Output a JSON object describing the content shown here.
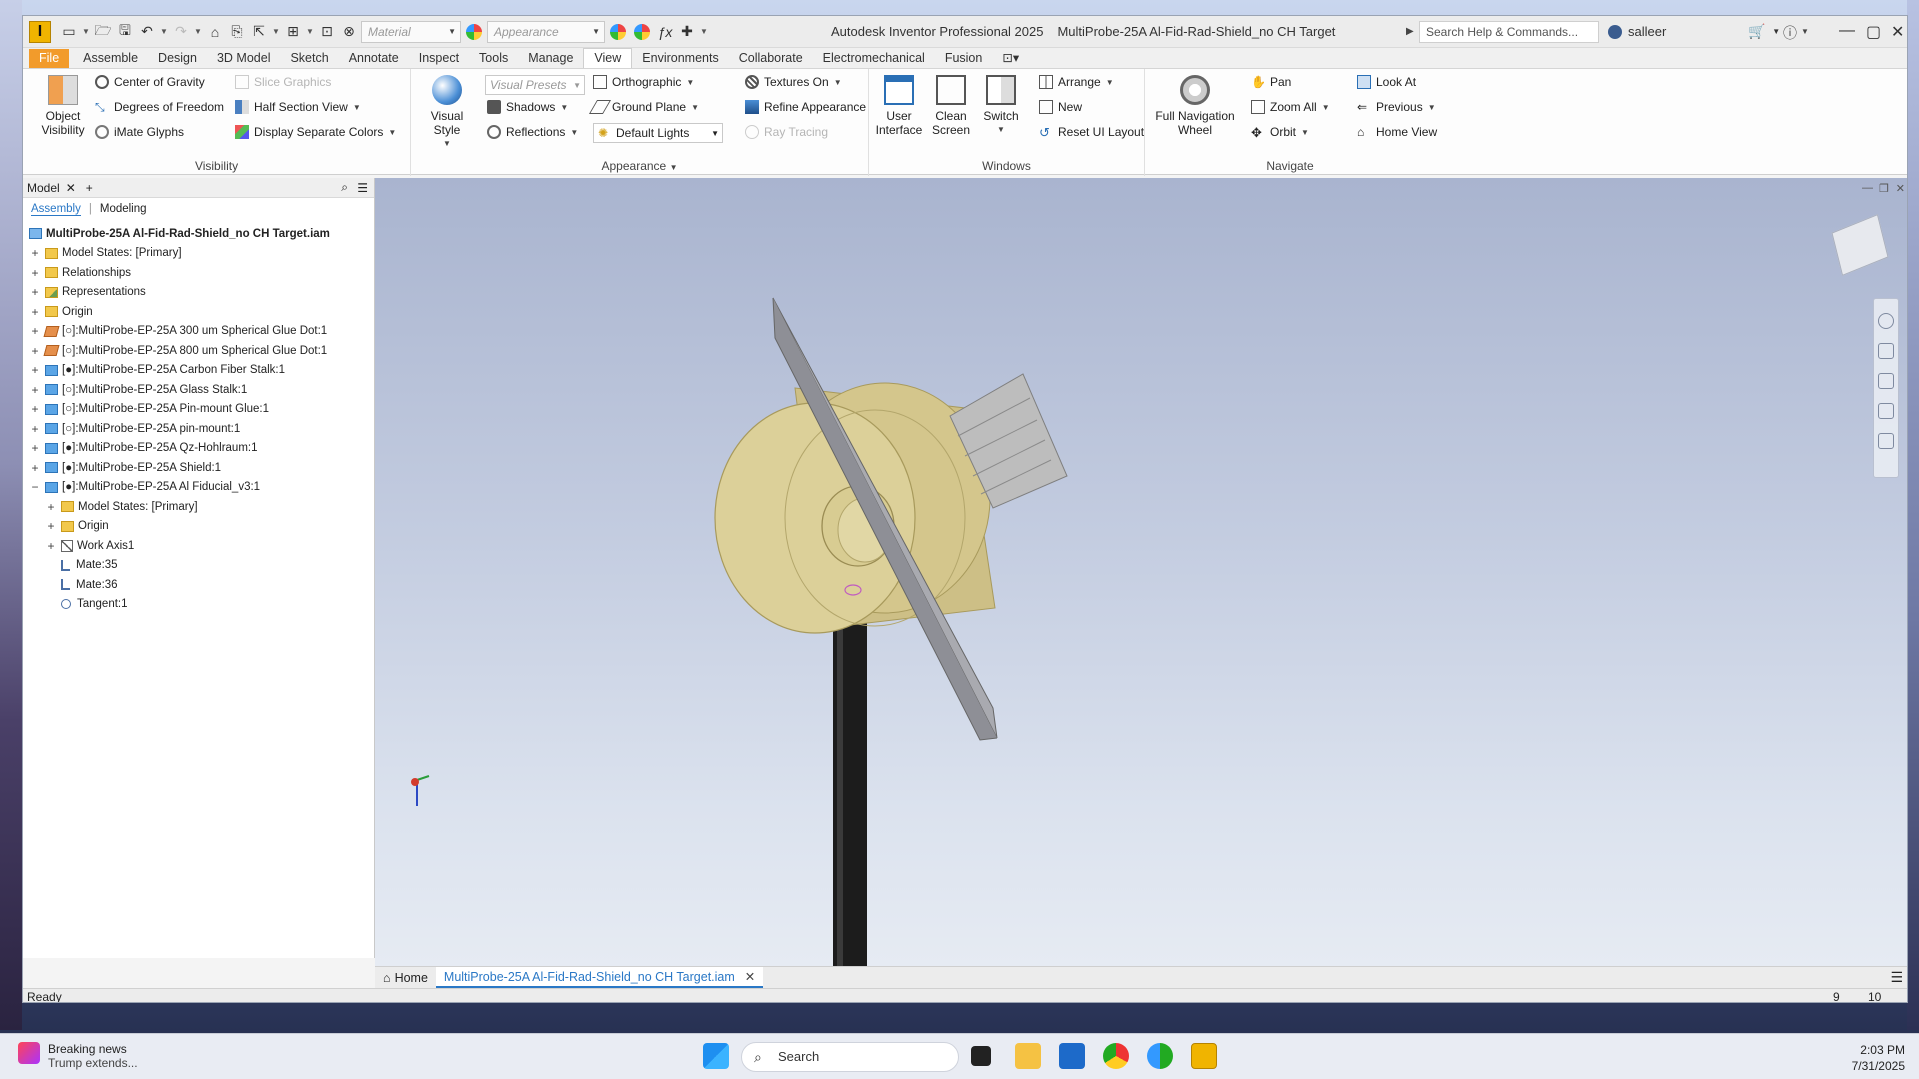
{
  "window": {
    "title": "Autodesk Inventor Professional 2025",
    "document": "MultiProbe-25A Al-Fid-Rad-Shield_no CH Target",
    "search_placeholder": "Search Help & Commands...",
    "user": "salleer"
  },
  "qat": {
    "material": "Material",
    "appearance": "Appearance"
  },
  "tabs": [
    "File",
    "Assemble",
    "Design",
    "3D Model",
    "Sketch",
    "Annotate",
    "Inspect",
    "Tools",
    "Manage",
    "View",
    "Environments",
    "Collaborate",
    "Electromechanical",
    "Fusion"
  ],
  "active_tab": "View",
  "ribbon": {
    "visibility": {
      "label": "Visibility",
      "object_visibility_1": "Object",
      "object_visibility_2": "Visibility",
      "center_of_gravity": "Center of Gravity",
      "degrees_of_freedom": "Degrees of Freedom",
      "imate_glyphs": "iMate Glyphs",
      "slice_graphics": "Slice Graphics",
      "half_section_view": "Half Section View",
      "display_separate_colors": "Display Separate Colors"
    },
    "appearance": {
      "label": "Appearance",
      "visual_style": "Visual Style",
      "visual_presets": "Visual Presets",
      "shadows": "Shadows",
      "reflections": "Reflections",
      "orthographic": "Orthographic",
      "ground_plane": "Ground Plane",
      "default_lights": "Default Lights",
      "textures_on": "Textures On",
      "refine_appearance": "Refine Appearance",
      "ray_tracing": "Ray Tracing"
    },
    "windows": {
      "label": "Windows",
      "user_interface_1": "User",
      "user_interface_2": "Interface",
      "clean_screen_1": "Clean",
      "clean_screen_2": "Screen",
      "switch": "Switch",
      "arrange": "Arrange",
      "new": "New",
      "reset_ui_layout": "Reset UI Layout"
    },
    "navigate": {
      "label": "Navigate",
      "full_nav_wheel_1": "Full Navigation",
      "full_nav_wheel_2": "Wheel",
      "pan": "Pan",
      "zoom_all": "Zoom All",
      "orbit": "Orbit",
      "look_at": "Look At",
      "previous": "Previous",
      "home_view": "Home View"
    }
  },
  "browser": {
    "tab": "Model",
    "sub_assembly": "Assembly",
    "sub_modeling": "Modeling",
    "root": "MultiProbe-25A Al-Fid-Rad-Shield_no CH Target.iam",
    "nodes": [
      "Model States: [Primary]",
      "Relationships",
      "Representations",
      "Origin",
      "[○]:MultiProbe-EP-25A 300 um Spherical Glue Dot:1",
      "[○]:MultiProbe-EP-25A 800 um Spherical Glue Dot:1",
      "[●]:MultiProbe-EP-25A Carbon Fiber Stalk:1",
      "[○]:MultiProbe-EP-25A Glass Stalk:1",
      "[○]:MultiProbe-EP-25A Pin-mount Glue:1",
      "[○]:MultiProbe-EP-25A pin-mount:1",
      "[●]:MultiProbe-EP-25A Qz-Hohlraum:1",
      "[●]:MultiProbe-EP-25A Shield:1",
      "[●]:MultiProbe-EP-25A Al Fiducial_v3:1"
    ],
    "children": [
      "Model States: [Primary]",
      "Origin",
      "Work Axis1",
      "Mate:35",
      "Mate:36",
      "Tangent:1"
    ]
  },
  "doc_tabs": {
    "home": "Home",
    "active": "MultiProbe-25A Al-Fid-Rad-Shield_no CH Target.iam"
  },
  "status": {
    "text": "Ready",
    "num1": "9",
    "num2": "10"
  },
  "taskbar": {
    "news_title": "Breaking news",
    "news_sub": "Trump extends...",
    "search": "Search",
    "time": "2:03 PM",
    "date": "7/31/2025"
  },
  "colors": {
    "accent": "#2a78c6",
    "file_tab": "#f29b2b",
    "cylinder": "#d6c98a",
    "plate": "#a9aab0",
    "stalk": "#1a1a1a"
  }
}
